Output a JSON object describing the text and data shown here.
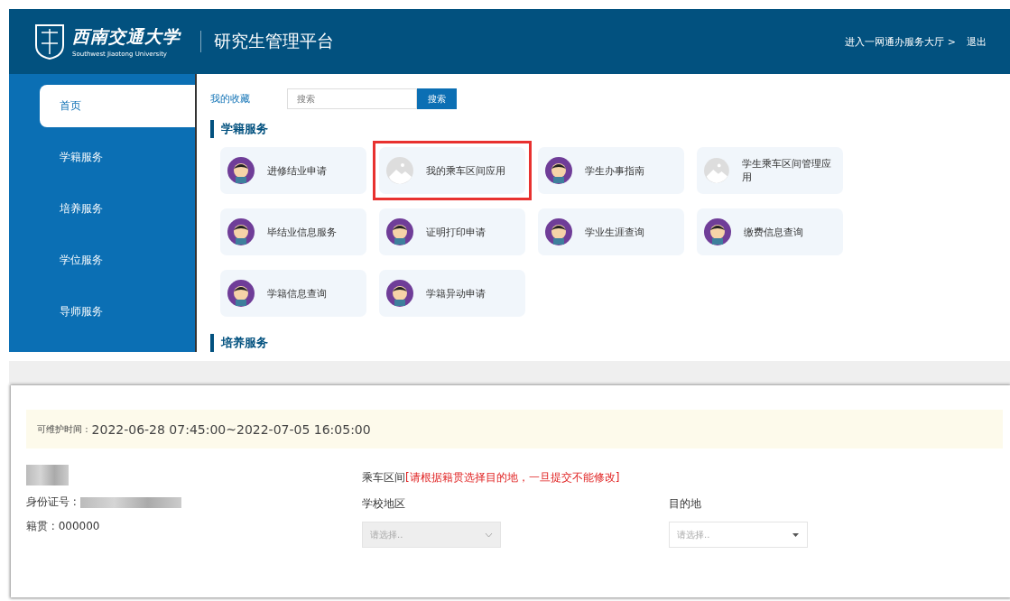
{
  "header": {
    "logo_name": "西南交通大学",
    "logo_subtitle": "Southwest Jiaotong University",
    "title": "研究生管理平台",
    "links": [
      "进入一网通办服务大厅 >",
      "退出"
    ]
  },
  "sidebar": {
    "items": [
      {
        "label": "首页",
        "selected": true
      },
      {
        "label": "学籍服务",
        "selected": false
      },
      {
        "label": "培养服务",
        "selected": false
      },
      {
        "label": "学位服务",
        "selected": false
      },
      {
        "label": "导师服务",
        "selected": false
      }
    ]
  },
  "search": {
    "label": "我的收藏",
    "placeholder": "搜索",
    "button": "搜索"
  },
  "sections": [
    {
      "title": "学籍服务",
      "tiles": [
        {
          "label": "进修结业申请",
          "kind": "avatar",
          "highlighted": false
        },
        {
          "label": "我的乘车区间应用",
          "kind": "image",
          "highlighted": true
        },
        {
          "label": "学生办事指南",
          "kind": "avatar",
          "highlighted": false
        },
        {
          "label": "学生乘车区间管理应用",
          "kind": "image",
          "highlighted": false
        },
        {
          "label": "毕结业信息服务",
          "kind": "avatar",
          "highlighted": false
        },
        {
          "label": "证明打印申请",
          "kind": "avatar",
          "highlighted": false
        },
        {
          "label": "学业生涯查询",
          "kind": "avatar",
          "highlighted": false
        },
        {
          "label": "缴费信息查询",
          "kind": "avatar",
          "highlighted": false
        },
        {
          "label": "学籍信息查询",
          "kind": "avatar",
          "highlighted": false
        },
        {
          "label": "学籍异动申请",
          "kind": "avatar",
          "highlighted": false
        }
      ]
    },
    {
      "title": "培养服务"
    }
  ],
  "form": {
    "notice_label": "可维护时间 :",
    "notice_value": "2022-06-28 07:45:00~2022-07-05 16:05:00",
    "id_label": "身份证号 :",
    "origin": "籍贯 : 000000",
    "route_label": "乘车区间",
    "route_warning": "[请根据籍贯选择目的地，一旦提交不能修改]",
    "selects": [
      {
        "label": "学校地区",
        "placeholder": "请选择..",
        "disabled": true
      },
      {
        "label": "目的地",
        "placeholder": "请选择..",
        "disabled": false
      }
    ]
  }
}
